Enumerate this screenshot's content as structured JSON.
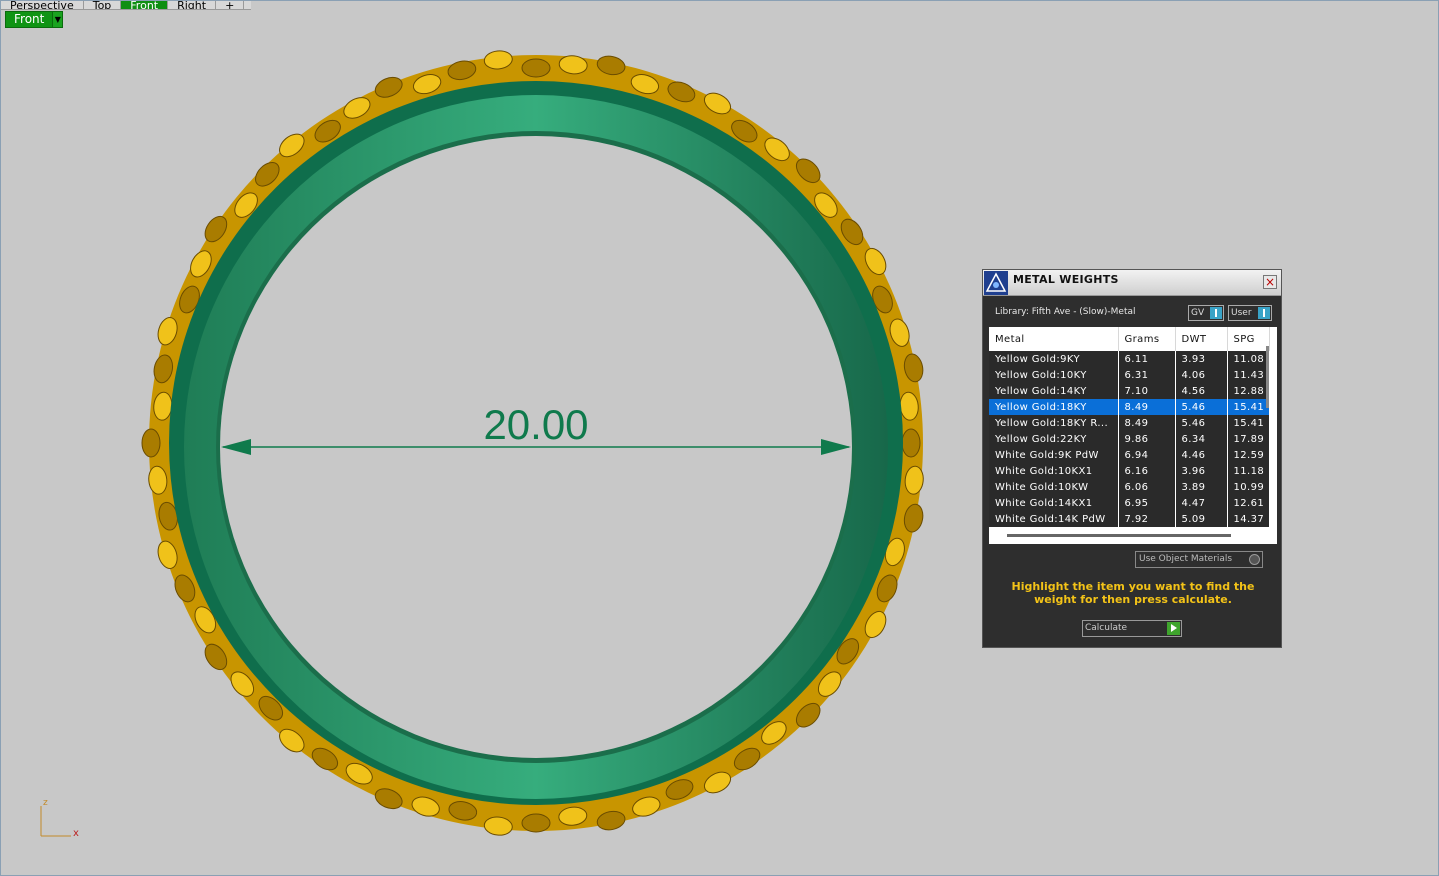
{
  "viewport": {
    "tabs": [
      "Perspective",
      "Top",
      "Front",
      "Right",
      "+"
    ],
    "active_label": "Front",
    "dimension_value": "20.00",
    "axis_x": "x",
    "axis_z": "z",
    "colors": {
      "background": "#c8c8c8",
      "band": "#2f9e6e",
      "gold": "#d9a300",
      "dimension": "#0f7a4c"
    }
  },
  "metal_weights": {
    "title": "METAL WEIGHTS",
    "library": "Library: Fifth Ave - (Slow)-Metal",
    "toggle_gv": "GV",
    "toggle_user": "User",
    "columns": [
      "Metal",
      "Grams",
      "DWT",
      "SPG"
    ],
    "rows": [
      {
        "metal": "Yellow Gold:9KY",
        "grams": "6.11",
        "dwt": "3.93",
        "spg": "11.08"
      },
      {
        "metal": "Yellow Gold:10KY",
        "grams": "6.31",
        "dwt": "4.06",
        "spg": "11.43"
      },
      {
        "metal": "Yellow Gold:14KY",
        "grams": "7.10",
        "dwt": "4.56",
        "spg": "12.88"
      },
      {
        "metal": "Yellow Gold:18KY",
        "grams": "8.49",
        "dwt": "5.46",
        "spg": "15.41"
      },
      {
        "metal": "Yellow Gold:18KY R...",
        "grams": "8.49",
        "dwt": "5.46",
        "spg": "15.41"
      },
      {
        "metal": "Yellow Gold:22KY",
        "grams": "9.86",
        "dwt": "6.34",
        "spg": "17.89"
      },
      {
        "metal": "White Gold:9K PdW",
        "grams": "6.94",
        "dwt": "4.46",
        "spg": "12.59"
      },
      {
        "metal": "White Gold:10KX1",
        "grams": "6.16",
        "dwt": "3.96",
        "spg": "11.18"
      },
      {
        "metal": "White Gold:10KW",
        "grams": "6.06",
        "dwt": "3.89",
        "spg": "10.99"
      },
      {
        "metal": "White Gold:14KX1",
        "grams": "6.95",
        "dwt": "4.47",
        "spg": "12.61"
      },
      {
        "metal": "White Gold:14K PdW",
        "grams": "7.92",
        "dwt": "5.09",
        "spg": "14.37"
      }
    ],
    "selected_index": 3,
    "use_object_materials": "Use Object Materials",
    "hint": "Highlight the item you want to find the weight for then press calculate.",
    "calculate": "Calculate",
    "colors": {
      "selected": "#0a6fd8",
      "hint": "#f3c318",
      "panel": "#2e2e2e"
    }
  }
}
